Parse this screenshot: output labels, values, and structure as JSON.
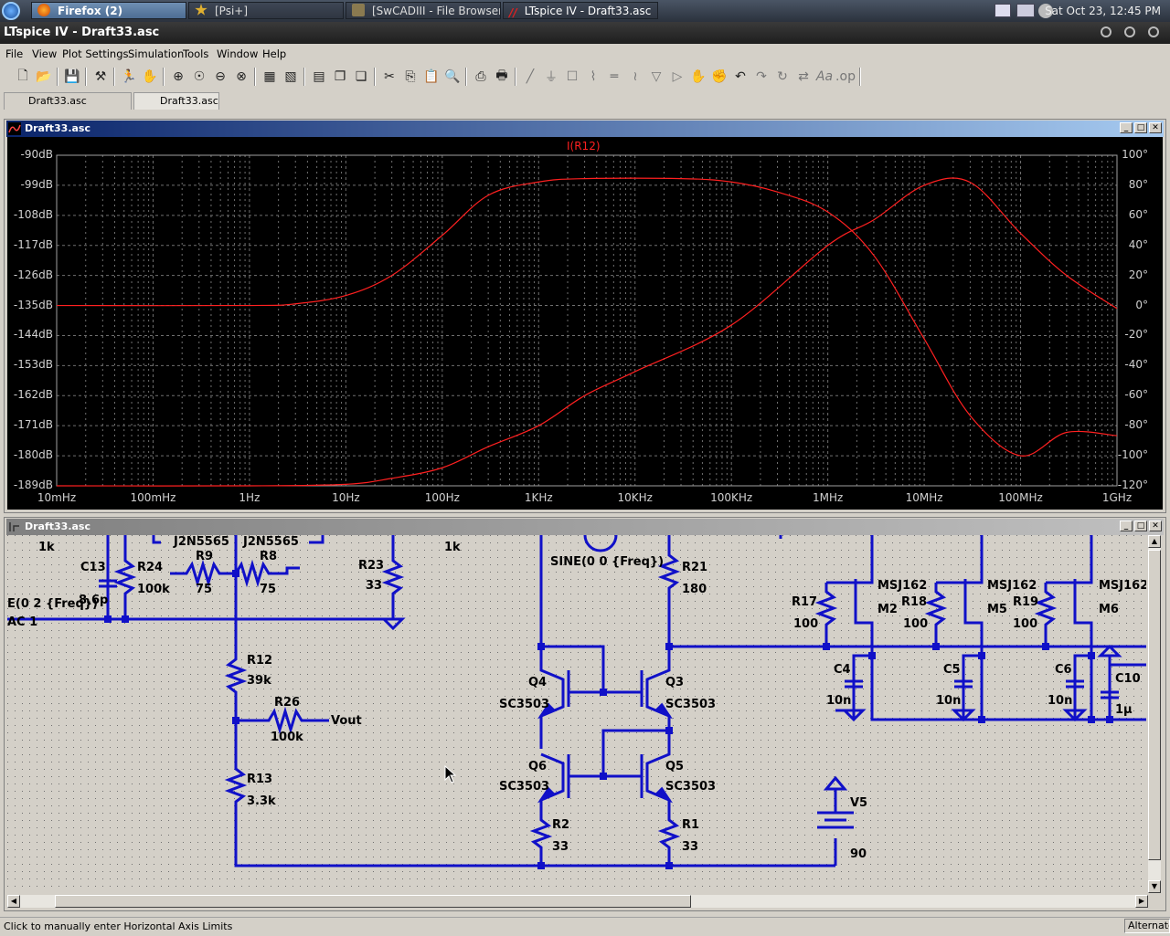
{
  "taskbar": {
    "tasks": [
      {
        "label": "Firefox (2)"
      },
      {
        "label": "[Psi+]"
      },
      {
        "label": "[SwCADIII - File Browser]"
      },
      {
        "label": "LTspice IV - Draft33.asc"
      }
    ],
    "clock": "Sat Oct 23, 12:45 PM"
  },
  "app": {
    "title": "LTspice IV - Draft33.asc"
  },
  "menu": [
    "File",
    "View",
    "Plot Settings",
    "Simulation",
    "Tools",
    "Window",
    "Help"
  ],
  "doc_tabs": [
    "Draft33.asc",
    "Draft33.asc"
  ],
  "plot_window": {
    "title": "Draft33.asc",
    "trace_label": "I(R12)",
    "trace_color": "#ff2020",
    "y_left_ticks": [
      "-90dB",
      "-99dB",
      "-108dB",
      "-117dB",
      "-126dB",
      "-135dB",
      "-144dB",
      "-153dB",
      "-162dB",
      "-171dB",
      "-180dB",
      "-189dB"
    ],
    "y_right_ticks": [
      "100°",
      "80°",
      "60°",
      "40°",
      "20°",
      "0°",
      "-20°",
      "-40°",
      "-60°",
      "-80°",
      "-100°",
      "-120°"
    ],
    "x_ticks": [
      "10mHz",
      "100mHz",
      "1Hz",
      "10Hz",
      "100Hz",
      "1KHz",
      "10KHz",
      "100KHz",
      "1MHz",
      "10MHz",
      "100MHz",
      "1GHz"
    ]
  },
  "chart_data": {
    "type": "line",
    "x_scale": "log",
    "x_unit": "Hz",
    "xlim": [
      0.01,
      1000000000
    ],
    "ylim_left": [
      -189,
      -90
    ],
    "ylim_right": [
      -120,
      100
    ],
    "grid": true,
    "series": [
      {
        "name": "I(R12)",
        "axis": "left",
        "x": [
          0.01,
          1,
          3,
          10,
          30,
          100,
          300,
          1000,
          3000,
          30000,
          100000,
          300000,
          1000000,
          3000000,
          10000000,
          30000000,
          100000000,
          300000000,
          1000000000
        ],
        "values": [
          -135,
          -135,
          -134.5,
          -132,
          -126,
          -114,
          -102,
          -98,
          -97,
          -97,
          -98,
          -101,
          -107,
          -120,
          -145,
          -168,
          -180,
          -173,
          -174
        ]
      },
      {
        "name": "phase",
        "axis": "right",
        "x": [
          0.01,
          1,
          10,
          30,
          100,
          300,
          1000,
          3000,
          10000,
          100000,
          1000000,
          3000000,
          10000000,
          30000000,
          100000000,
          300000000,
          1000000000
        ],
        "values": [
          -120,
          -120,
          -119,
          -115,
          -108,
          -94,
          -80,
          -60,
          -44,
          -13,
          40,
          57,
          80,
          82,
          48,
          20,
          -2
        ]
      }
    ]
  },
  "schematic_window": {
    "title": "Draft33.asc",
    "labels": [
      {
        "t": "1k"
      },
      {
        "t": "C13"
      },
      {
        "t": "R24"
      },
      {
        "t": "8.6p"
      },
      {
        "t": "100k"
      },
      {
        "t": "J2N5565"
      },
      {
        "t": "J2N5565"
      },
      {
        "t": "R9"
      },
      {
        "t": "R8"
      },
      {
        "t": "75"
      },
      {
        "t": "75"
      },
      {
        "t": "R23"
      },
      {
        "t": "33"
      },
      {
        "t": "1k"
      },
      {
        "t": "SINE(0 0 {Freq})"
      },
      {
        "t": "R21"
      },
      {
        "t": "180"
      },
      {
        "t": "E(0 2 {Freq})"
      },
      {
        "t": "AC 1"
      },
      {
        "t": "R12"
      },
      {
        "t": "39k"
      },
      {
        "t": "R26"
      },
      {
        "t": "Vout"
      },
      {
        "t": "100k"
      },
      {
        "t": "R13"
      },
      {
        "t": "3.3k"
      },
      {
        "t": "Q4"
      },
      {
        "t": "SC3503"
      },
      {
        "t": "Q3"
      },
      {
        "t": "SC3503"
      },
      {
        "t": "Q6"
      },
      {
        "t": "SC3503"
      },
      {
        "t": "Q5"
      },
      {
        "t": "SC3503"
      },
      {
        "t": "R2"
      },
      {
        "t": "33"
      },
      {
        "t": "R1"
      },
      {
        "t": "33"
      },
      {
        "t": "V5"
      },
      {
        "t": "90"
      },
      {
        "t": "MSJ162"
      },
      {
        "t": "M2"
      },
      {
        "t": "R17"
      },
      {
        "t": "100"
      },
      {
        "t": "MSJ162"
      },
      {
        "t": "M5"
      },
      {
        "t": "R18"
      },
      {
        "t": "100"
      },
      {
        "t": "MSJ162"
      },
      {
        "t": "M6"
      },
      {
        "t": "R19"
      },
      {
        "t": "100"
      },
      {
        "t": "C4"
      },
      {
        "t": "10n"
      },
      {
        "t": "C5"
      },
      {
        "t": "10n"
      },
      {
        "t": "C6"
      },
      {
        "t": "10n"
      },
      {
        "t": "C10"
      },
      {
        "t": "1µ"
      }
    ]
  },
  "status": {
    "left": "Click to manually enter Horizontal Axis Limits",
    "right": "Alternate"
  }
}
